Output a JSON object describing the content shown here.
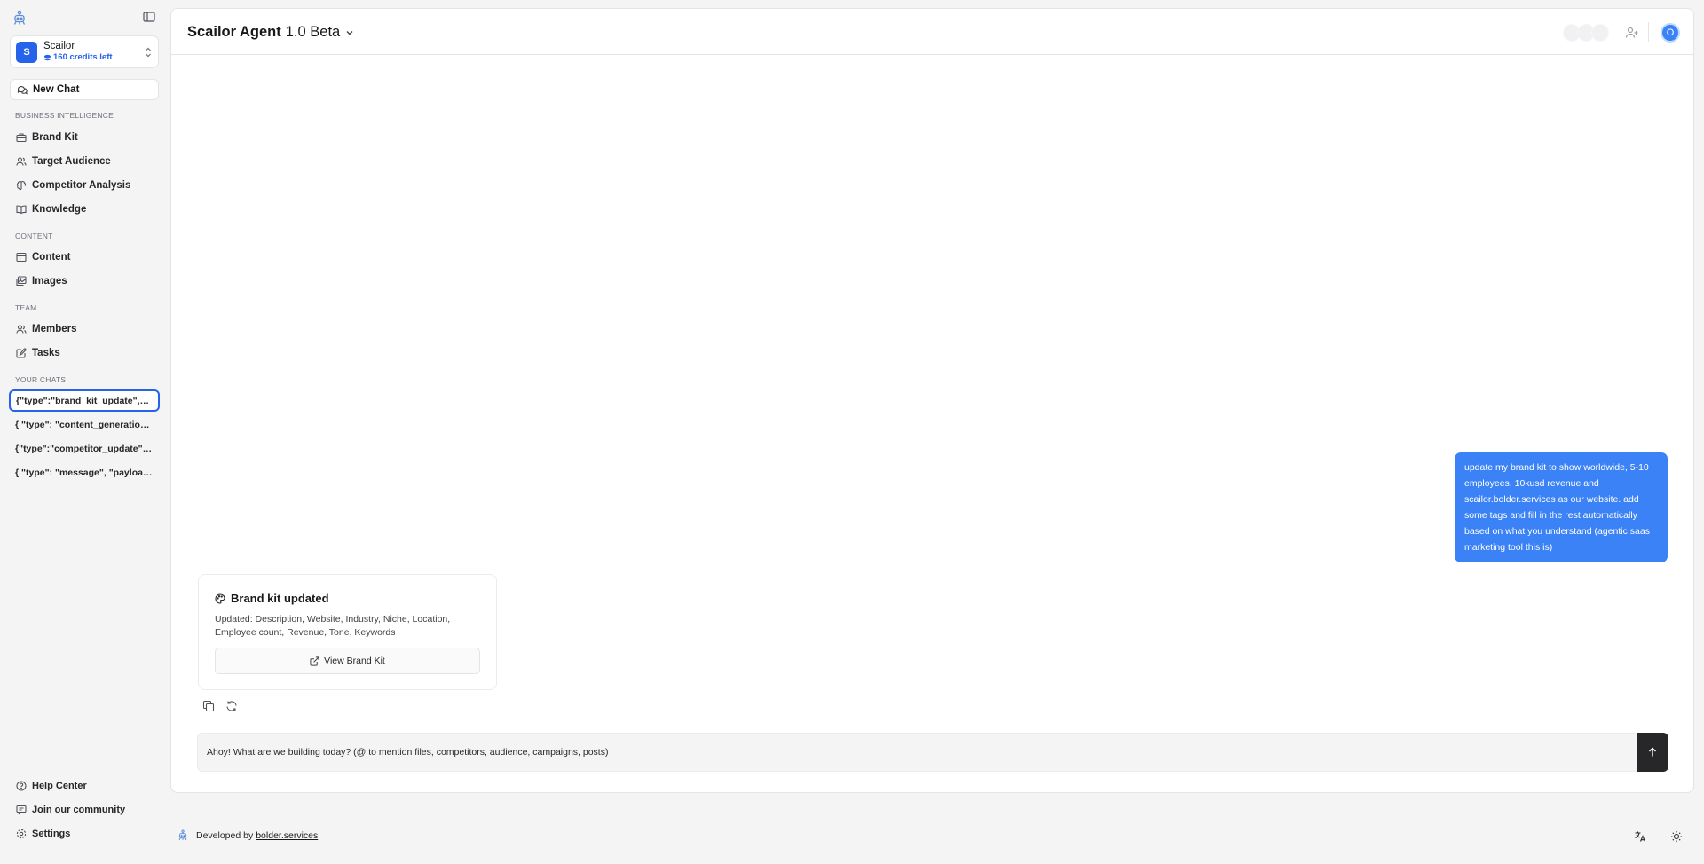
{
  "sidebar": {
    "workspace": {
      "initial": "S",
      "name": "Scailor",
      "credits": "160 credits left"
    },
    "new_chat": "New Chat",
    "sections": {
      "business": "BUSINESS INTELLIGENCE",
      "content": "CONTENT",
      "team": "TEAM",
      "chats": "YOUR CHATS"
    },
    "business_items": [
      "Brand Kit",
      "Target Audience",
      "Competitor Analysis",
      "Knowledge"
    ],
    "content_items": [
      "Content",
      "Images"
    ],
    "team_items": [
      "Members",
      "Tasks"
    ],
    "chats": [
      "{\"type\":\"brand_kit_update\",\"payload\":{",
      "{ \"type\": \"content_generation\", \"payload\": {",
      "{\"type\":\"competitor_update\",\"payload\":{",
      "{ \"type\": \"message\", \"payload\": { \"text\""
    ],
    "footer_items": [
      "Help Center",
      "Join our community",
      "Settings"
    ]
  },
  "header": {
    "title": "Scailor Agent",
    "version": "1.0 Beta",
    "user_initial": "O"
  },
  "conversation": {
    "user_message": "update my brand kit to show worldwide, 5-10 employees, 10kusd revenue and scailor.bolder.services as our website. add some tags and fill in the rest automatically based on what you understand (agentic saas marketing tool this is)",
    "card": {
      "title": "Brand kit updated",
      "description": "Updated: Description, Website, Industry, Niche, Location, Employee count, Revenue, Tone, Keywords",
      "button": "View Brand Kit"
    }
  },
  "composer": {
    "placeholder": "Ahoy! What are we building today? (@ to mention files, competitors, audience, campaigns, posts)",
    "value": ""
  },
  "footer": {
    "developed_by": "Developed by",
    "link": "bolder.services"
  },
  "colors": {
    "accent": "#2563eb",
    "bubble": "#3b82f6",
    "send": "#27272a"
  }
}
